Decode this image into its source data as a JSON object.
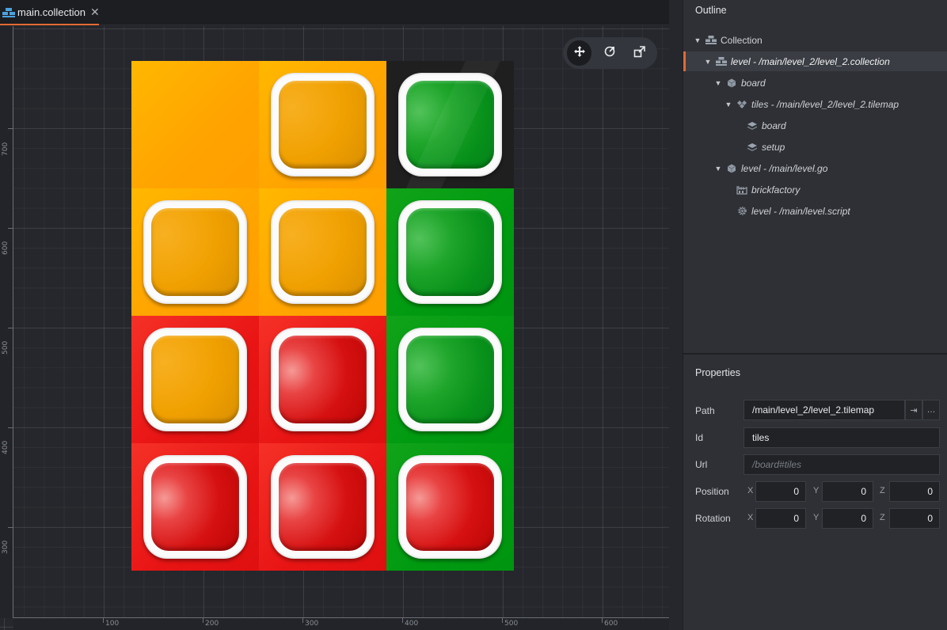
{
  "tab": {
    "label": "main.collection",
    "close_icon": "close-icon"
  },
  "rulers": {
    "vertical": [
      "700",
      "600",
      "500",
      "400",
      "300"
    ],
    "horizontal": [
      "100",
      "200",
      "300",
      "400",
      "500",
      "600"
    ]
  },
  "tools": [
    {
      "name": "move-tool-icon",
      "active": true
    },
    {
      "name": "rotate-tool-icon",
      "active": false
    },
    {
      "name": "scale-tool-icon",
      "active": false
    }
  ],
  "board": {
    "rows": [
      [
        {
          "bg": "orange",
          "brick": null
        },
        {
          "bg": "orange",
          "brick": "orange"
        },
        {
          "bg": "dark",
          "brick": "green"
        }
      ],
      [
        {
          "bg": "orange",
          "brick": "orange"
        },
        {
          "bg": "orange",
          "brick": "orange"
        },
        {
          "bg": "green",
          "brick": "green"
        }
      ],
      [
        {
          "bg": "red",
          "brick": "orange"
        },
        {
          "bg": "red",
          "brick": "red"
        },
        {
          "bg": "green",
          "brick": "green"
        }
      ],
      [
        {
          "bg": "red",
          "brick": "red"
        },
        {
          "bg": "red",
          "brick": "red"
        },
        {
          "bg": "green",
          "brick": "red"
        }
      ]
    ]
  },
  "outline": {
    "title": "Outline",
    "items": [
      {
        "label": "Collection",
        "icon": "collection-icon",
        "depth": 0,
        "italic": false,
        "expanded": true,
        "selected": false
      },
      {
        "label": "level - /main/level_2/level_2.collection",
        "icon": "collection-icon",
        "depth": 1,
        "italic": true,
        "expanded": true,
        "selected": true
      },
      {
        "label": "board",
        "icon": "game-object-icon",
        "depth": 2,
        "italic": true,
        "expanded": true,
        "selected": false
      },
      {
        "label": "tiles - /main/level_2/level_2.tilemap",
        "icon": "tilemap-icon",
        "depth": 3,
        "italic": true,
        "expanded": true,
        "selected": false
      },
      {
        "label": "board",
        "icon": "layer-icon",
        "depth": 4,
        "italic": true,
        "expanded": null,
        "selected": false
      },
      {
        "label": "setup",
        "icon": "layer-icon",
        "depth": 4,
        "italic": true,
        "expanded": null,
        "selected": false
      },
      {
        "label": "level - /main/level.go",
        "icon": "game-object-icon",
        "depth": 2,
        "italic": true,
        "expanded": true,
        "selected": false
      },
      {
        "label": "brickfactory",
        "icon": "factory-icon",
        "depth": 3,
        "italic": true,
        "expanded": null,
        "selected": false
      },
      {
        "label": "level - /main/level.script",
        "icon": "script-gear-icon",
        "depth": 3,
        "italic": true,
        "expanded": null,
        "selected": false
      }
    ]
  },
  "properties": {
    "title": "Properties",
    "path": {
      "label": "Path",
      "value": "/main/level_2/level_2.tilemap",
      "goto": "⇥",
      "browse": "…"
    },
    "id": {
      "label": "Id",
      "value": "tiles"
    },
    "url": {
      "label": "Url",
      "placeholder": "/board#tiles"
    },
    "position": {
      "label": "Position",
      "x": "0",
      "y": "0",
      "z": "0"
    },
    "rotation": {
      "label": "Rotation",
      "x": "0",
      "y": "0",
      "z": "0"
    },
    "axes": {
      "x": "X",
      "y": "Y",
      "z": "Z"
    }
  },
  "colors": {
    "accent": "#e36a34"
  }
}
